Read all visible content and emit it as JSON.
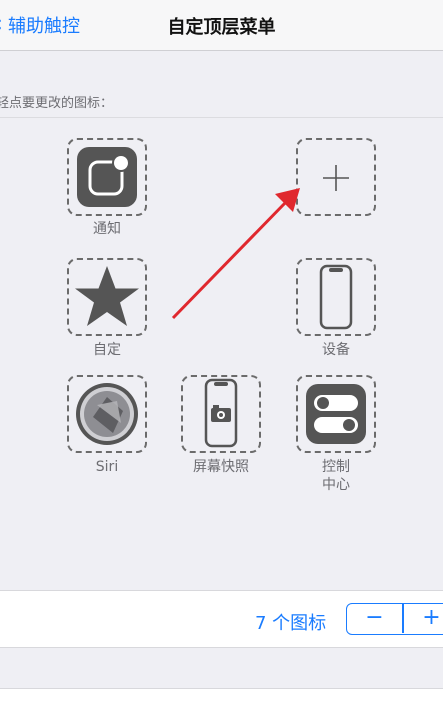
{
  "nav": {
    "back_label": "辅助触控",
    "title": "自定顶层菜单"
  },
  "hint": "轻点要更改的图标：",
  "icons": [
    {
      "label": "通知",
      "icon": "notification-icon"
    },
    {
      "label": "",
      "icon": "plus-icon"
    },
    {
      "label": "自定",
      "icon": "star-icon"
    },
    {
      "label": "设备",
      "icon": "device-icon"
    },
    {
      "label": "Siri",
      "icon": "siri-icon"
    },
    {
      "label": "屏幕快照",
      "icon": "screenshot-icon"
    },
    {
      "label": "控制\n中心",
      "icon": "control-center-icon"
    }
  ],
  "toolbar": {
    "count_label": "7 个图标",
    "minus": "−",
    "plus": "+"
  },
  "colors": {
    "accent": "#1a7cff",
    "arrow": "#e0282e",
    "tile": "#555555"
  }
}
